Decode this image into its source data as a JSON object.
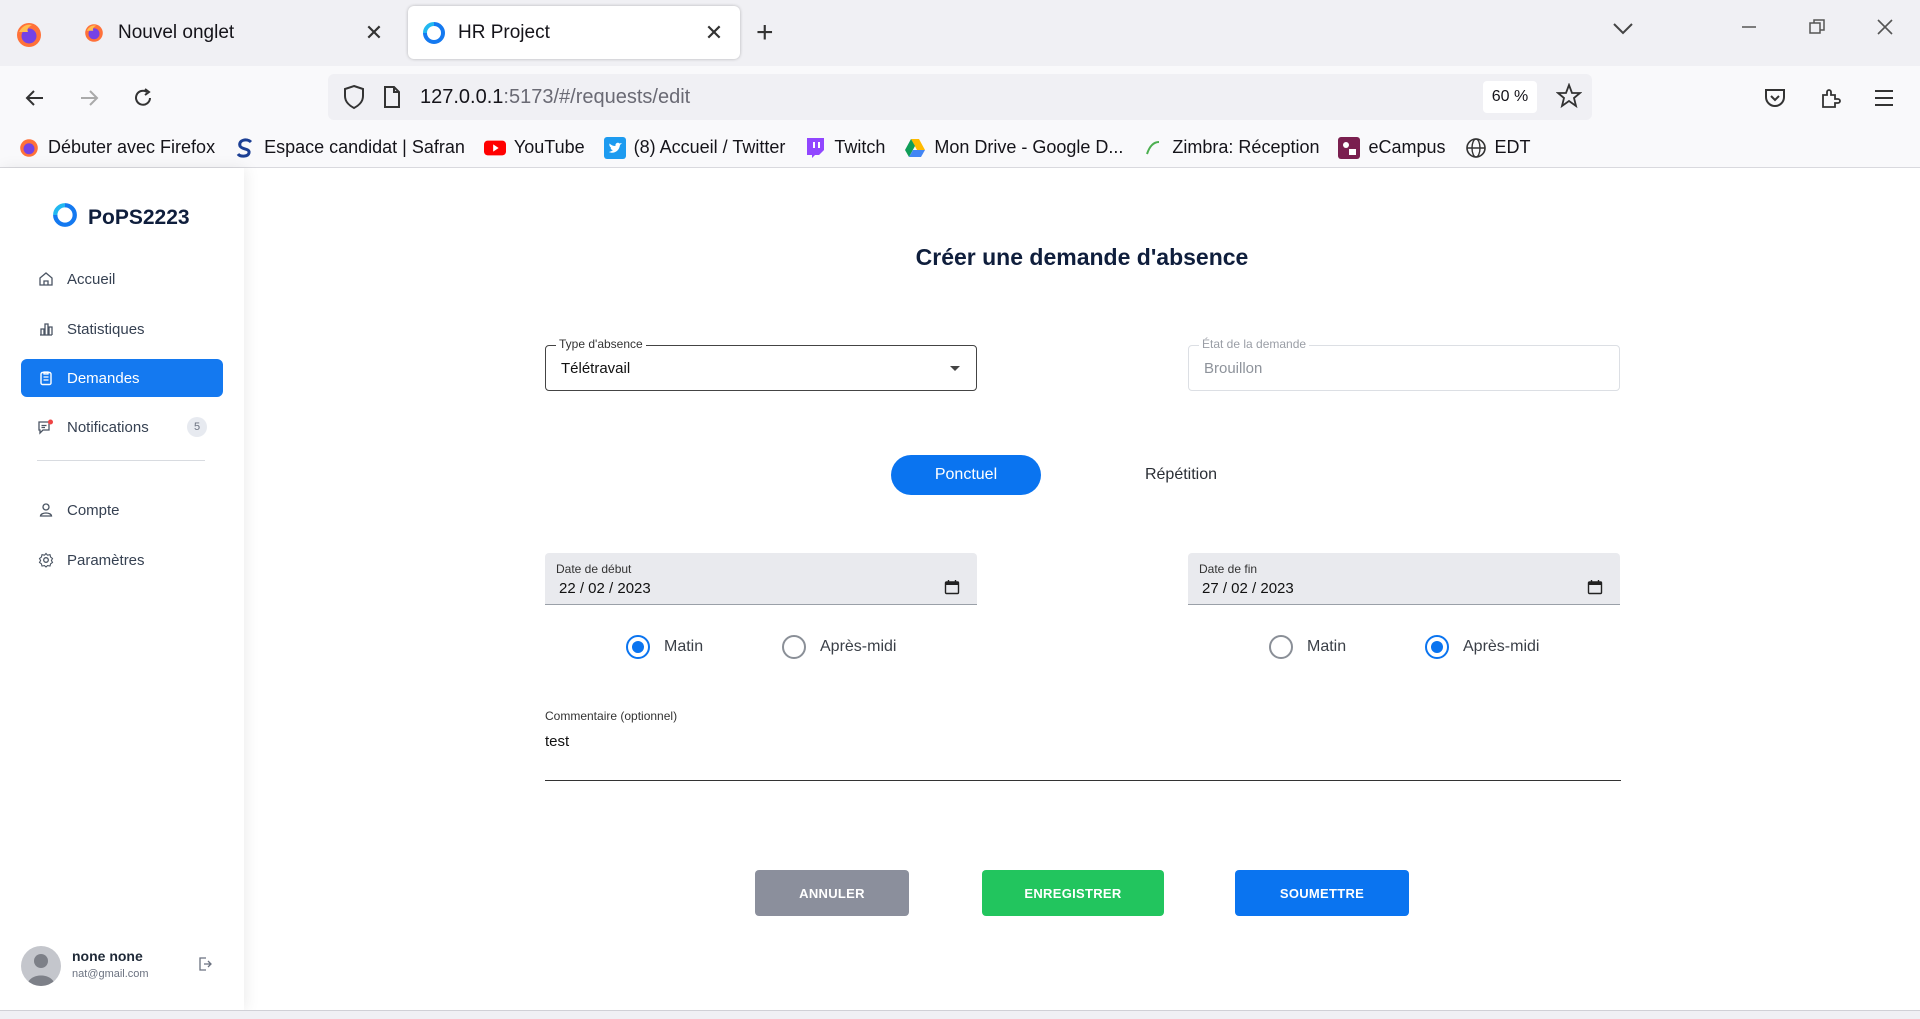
{
  "browser": {
    "tabs": [
      {
        "title": "Nouvel onglet",
        "icon": "firefox-icon"
      },
      {
        "title": "HR Project",
        "icon": "app-logo-icon"
      }
    ],
    "url_host": "127.0.0.1",
    "url_rest": ":5173/#/requests/edit",
    "zoom": "60 %",
    "bookmarks": [
      {
        "label": "Débuter avec Firefox",
        "icon": "firefox-icon"
      },
      {
        "label": "Espace candidat | Safran",
        "icon": "safran-icon"
      },
      {
        "label": "YouTube",
        "icon": "youtube-icon"
      },
      {
        "label": "(8) Accueil / Twitter",
        "icon": "twitter-icon"
      },
      {
        "label": "Twitch",
        "icon": "twitch-icon"
      },
      {
        "label": "Mon Drive - Google D...",
        "icon": "google-drive-icon"
      },
      {
        "label": "Zimbra: Réception",
        "icon": "zimbra-icon"
      },
      {
        "label": "eCampus",
        "icon": "ecampus-icon"
      },
      {
        "label": "EDT",
        "icon": "globe-icon"
      }
    ]
  },
  "sidebar": {
    "brand": "PoPS2223",
    "items": [
      {
        "label": "Accueil",
        "icon": "home-icon"
      },
      {
        "label": "Statistiques",
        "icon": "chart-icon"
      },
      {
        "label": "Demandes",
        "icon": "clipboard-icon"
      },
      {
        "label": "Notifications",
        "icon": "notification-icon",
        "badge": "5"
      },
      {
        "label": "Compte",
        "icon": "user-icon"
      },
      {
        "label": "Paramètres",
        "icon": "gear-icon"
      }
    ],
    "user": {
      "name": "none none",
      "email": "nat@gmail.com"
    }
  },
  "form": {
    "title": "Créer une demande d'absence",
    "type_label": "Type d'absence",
    "type_value": "Télétravail",
    "state_label": "État de la demande",
    "state_value": "Brouillon",
    "mode_ponctuel": "Ponctuel",
    "mode_repetition": "Répétition",
    "start_label": "Date de début",
    "start_value": "22 / 02 / 2023",
    "end_label": "Date de fin",
    "end_value": "27 / 02 / 2023",
    "radio_morning": "Matin",
    "radio_afternoon": "Après-midi",
    "start_period": "Matin",
    "end_period": "Après-midi",
    "comment_label": "Commentaire (optionnel)",
    "comment_value": "test",
    "btn_cancel": "ANNULER",
    "btn_save": "ENREGISTRER",
    "btn_submit": "SOUMETTRE"
  },
  "colors": {
    "primary": "#0a74f0",
    "save": "#22c55e",
    "cancel": "#8b8f9c"
  }
}
